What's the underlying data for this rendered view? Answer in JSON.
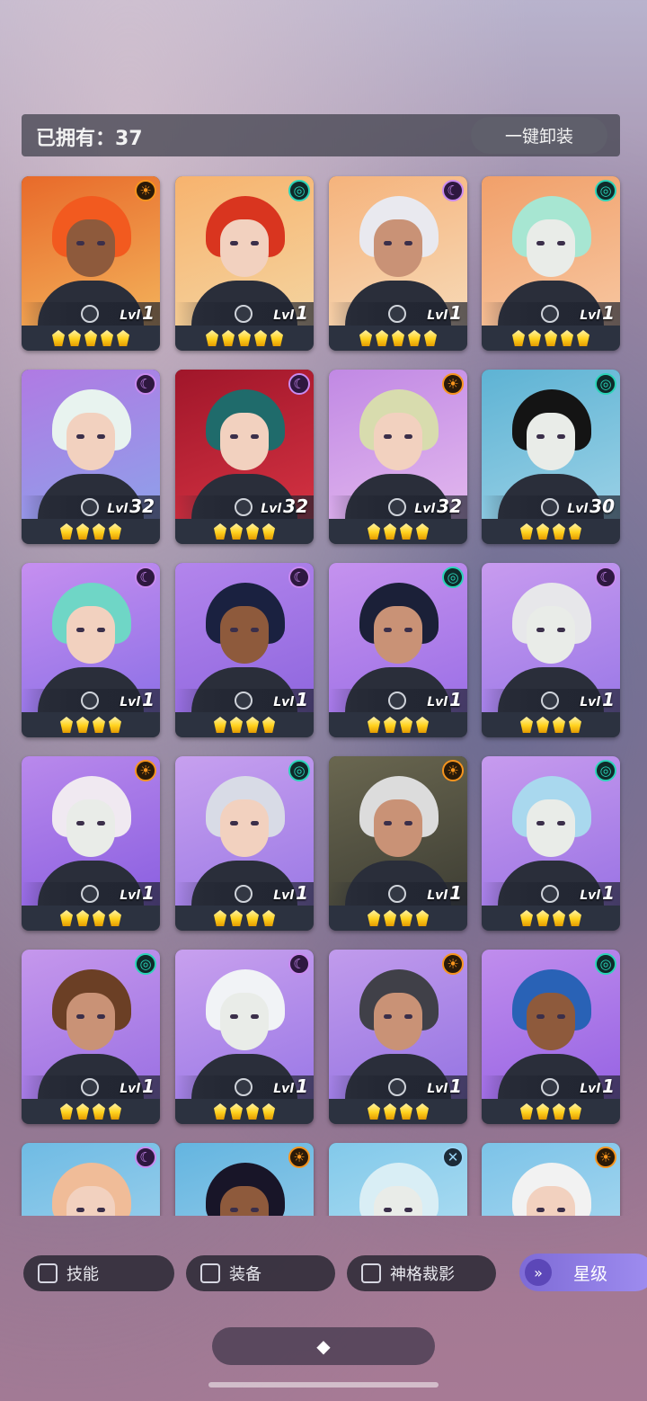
{
  "header": {
    "owned_label": "已拥有：37",
    "unequip_label": "一键卸装"
  },
  "element_icons": {
    "sun": "☀",
    "swirl": "◎",
    "moon": "☾",
    "cross": "✕"
  },
  "cards": [
    {
      "element": "sun",
      "level": "1",
      "stars": 5,
      "bg": [
        "#e86a2a",
        "#f3b25b"
      ],
      "hair": "#f25a1f",
      "skin": "dark"
    },
    {
      "element": "swirl",
      "level": "1",
      "stars": 5,
      "bg": [
        "#f7b36e",
        "#f4d4a0"
      ],
      "hair": "#d9351f",
      "skin": "light"
    },
    {
      "element": "moon",
      "level": "1",
      "stars": 5,
      "bg": [
        "#f5b37c",
        "#f7d9b6"
      ],
      "hair": "#e9e9ef",
      "skin": "tan"
    },
    {
      "element": "swirl",
      "level": "1",
      "stars": 5,
      "bg": [
        "#f1a06a",
        "#f7c6a0"
      ],
      "hair": "#a7e6d2",
      "skin": "pale"
    },
    {
      "element": "moon",
      "level": "32",
      "stars": 4,
      "bg": [
        "#b07ae3",
        "#8ea0ea"
      ],
      "hair": "#e8f3ef",
      "skin": "light"
    },
    {
      "element": "moon",
      "level": "32",
      "stars": 4,
      "bg": [
        "#a0162a",
        "#d43242"
      ],
      "hair": "#1f6b6b",
      "skin": "light"
    },
    {
      "element": "sun",
      "level": "32",
      "stars": 4,
      "bg": [
        "#c189e4",
        "#e2b7ee"
      ],
      "hair": "#d8dcae",
      "skin": "light"
    },
    {
      "element": "swirl",
      "level": "30",
      "stars": 4,
      "bg": [
        "#5eb3d4",
        "#9ad1e6"
      ],
      "hair": "#141414",
      "skin": "pale"
    },
    {
      "element": "moon",
      "level": "1",
      "stars": 4,
      "bg": [
        "#c68ff0",
        "#8c70e6"
      ],
      "hair": "#6fd6c6",
      "skin": "light"
    },
    {
      "element": "moon",
      "level": "1",
      "stars": 4,
      "bg": [
        "#b385ec",
        "#8e66de"
      ],
      "hair": "#1a2140",
      "skin": "dark"
    },
    {
      "element": "swirl",
      "level": "1",
      "stars": 4,
      "bg": [
        "#c592ee",
        "#9b6fe6"
      ],
      "hair": "#1b2038",
      "skin": "tan"
    },
    {
      "element": "moon",
      "level": "1",
      "stars": 4,
      "bg": [
        "#c89bef",
        "#9a78e7"
      ],
      "hair": "#e7e7ea",
      "skin": "pale"
    },
    {
      "element": "sun",
      "level": "1",
      "stars": 4,
      "bg": [
        "#b989ec",
        "#8a5fe0"
      ],
      "hair": "#f0e9f1",
      "skin": "pale"
    },
    {
      "element": "swirl",
      "level": "1",
      "stars": 4,
      "bg": [
        "#c7a0ef",
        "#9b79e5"
      ],
      "hair": "#d8dbe6",
      "skin": "light"
    },
    {
      "element": "sun",
      "level": "1",
      "stars": 4,
      "bg": [
        "#6a6750",
        "#3e3e34"
      ],
      "hair": "#dcdcdc",
      "skin": "tan"
    },
    {
      "element": "swirl",
      "level": "1",
      "stars": 4,
      "bg": [
        "#c79bee",
        "#9a73e4"
      ],
      "hair": "#a9d8ee",
      "skin": "pale"
    },
    {
      "element": "swirl",
      "level": "1",
      "stars": 4,
      "bg": [
        "#c597ec",
        "#9a70e3"
      ],
      "hair": "#6b3f25",
      "skin": "tan"
    },
    {
      "element": "moon",
      "level": "1",
      "stars": 4,
      "bg": [
        "#c8a0ee",
        "#9a78e6"
      ],
      "hair": "#f1f3f6",
      "skin": "pale"
    },
    {
      "element": "sun",
      "level": "1",
      "stars": 4,
      "bg": [
        "#c19bec",
        "#9574e2"
      ],
      "hair": "#404048",
      "skin": "tan"
    },
    {
      "element": "swirl",
      "level": "1",
      "stars": 4,
      "bg": [
        "#c08ded",
        "#9663e3"
      ],
      "hair": "#2962b6",
      "skin": "dark"
    },
    {
      "element": "moon",
      "level": "",
      "stars": 0,
      "bg": [
        "#6fbbe4",
        "#a8d6ee"
      ],
      "hair": "#f0bc98",
      "skin": "light"
    },
    {
      "element": "sun",
      "level": "",
      "stars": 0,
      "bg": [
        "#64b5e0",
        "#9fd1ec"
      ],
      "hair": "#181528",
      "skin": "dark"
    },
    {
      "element": "cross",
      "level": "",
      "stars": 0,
      "bg": [
        "#82c9ea",
        "#bbe3f4"
      ],
      "hair": "#d9eef5",
      "skin": "pale"
    },
    {
      "element": "sun",
      "level": "",
      "stars": 0,
      "bg": [
        "#7cc3e8",
        "#b5def2"
      ],
      "hair": "#f2f2f2",
      "skin": "light"
    }
  ],
  "level_prefix": "Lvl",
  "filters": [
    {
      "label": "技能"
    },
    {
      "label": "装备"
    },
    {
      "label": "神格裁影"
    }
  ],
  "sort": {
    "label": "星级",
    "icon": "double-chevron-down-icon"
  },
  "collapse_icon": "◆"
}
